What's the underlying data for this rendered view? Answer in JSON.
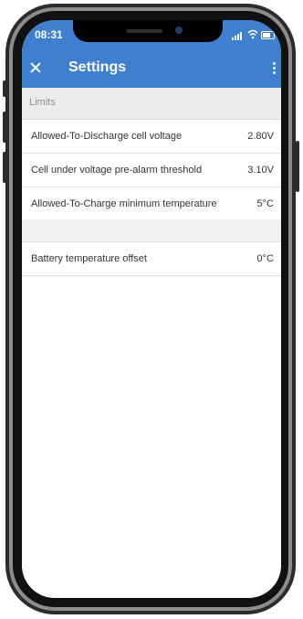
{
  "status_bar": {
    "time": "08:31"
  },
  "app_bar": {
    "title": "Settings",
    "close_icon": "close-icon",
    "menu_icon": "more-vertical-icon"
  },
  "colors": {
    "accent": "#3f7fd0",
    "section_background": "#ececee"
  },
  "section": {
    "header": "Limits",
    "rows": [
      {
        "label": "Allowed-To-Discharge cell voltage",
        "value": "2.80V"
      },
      {
        "label": "Cell under voltage pre-alarm threshold",
        "value": "3.10V"
      },
      {
        "label": "Allowed-To-Charge minimum temperature",
        "value": "5°C"
      }
    ]
  },
  "second_section": {
    "rows": [
      {
        "label": "Battery temperature offset",
        "value": "0°C"
      }
    ]
  }
}
